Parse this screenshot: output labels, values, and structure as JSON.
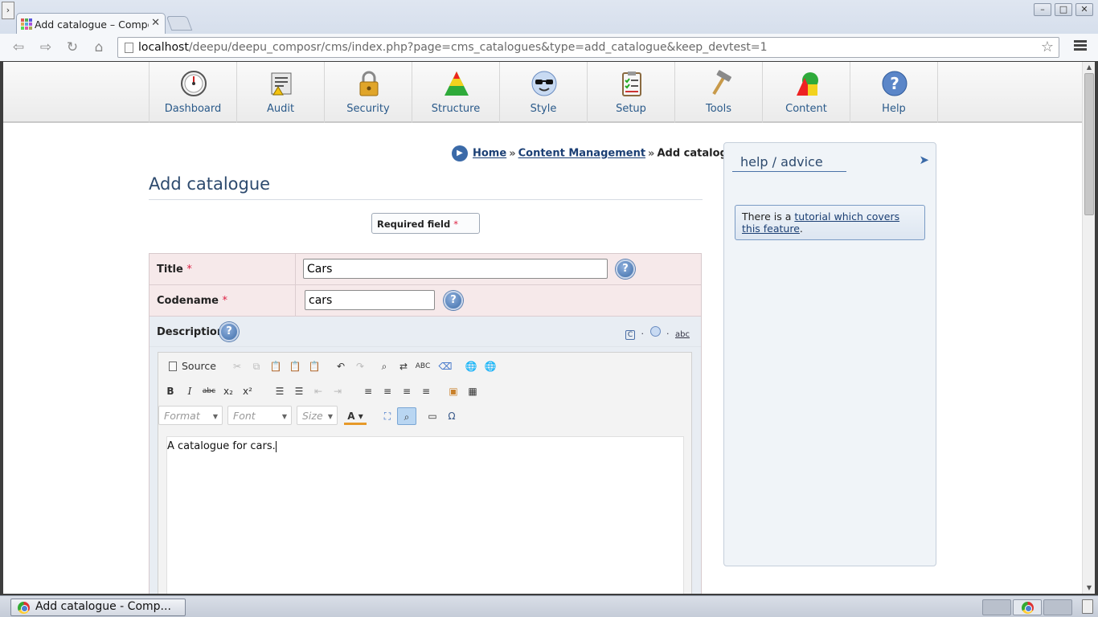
{
  "browser": {
    "tab_title": "Add catalogue – Compo",
    "url_host": "localhost",
    "url_path": "/deepu/deepu_composr/cms/index.php?page=cms_catalogues&type=add_catalogue&keep_devtest=1",
    "side_toggle": "›"
  },
  "admin_menu": {
    "items": [
      {
        "label": "Dashboard",
        "icon": "dashboard-gauge-icon"
      },
      {
        "label": "Audit",
        "icon": "audit-log-icon"
      },
      {
        "label": "Security",
        "icon": "padlock-icon"
      },
      {
        "label": "Structure",
        "icon": "pyramid-icon"
      },
      {
        "label": "Style",
        "icon": "sunglasses-face-icon"
      },
      {
        "label": "Setup",
        "icon": "clipboard-checklist-icon"
      },
      {
        "label": "Tools",
        "icon": "hammer-icon"
      },
      {
        "label": "Content",
        "icon": "shapes-icon"
      },
      {
        "label": "Help",
        "icon": "question-mark-icon"
      }
    ]
  },
  "breadcrumb": {
    "home": "Home",
    "sep": "»",
    "content_management": "Content Management",
    "current": "Add catalogue"
  },
  "page": {
    "title": "Add catalogue",
    "required_label": "Required field",
    "required_mark": "*"
  },
  "form": {
    "title_label": "Title",
    "title_value": "Cars",
    "codename_label": "Codename",
    "codename_value": "cars",
    "description_label": "Description",
    "help_glyph": "?",
    "desc_tools": [
      "Comcode",
      "·",
      "WYSIWYG",
      "·",
      "spellcheck"
    ]
  },
  "editor": {
    "source_label": "Source",
    "format_placeholder": "Format",
    "font_placeholder": "Font",
    "size_placeholder": "Size",
    "content": "A catalogue for cars."
  },
  "help_panel": {
    "title": "help / advice",
    "note_prefix": "There is a ",
    "note_link": "tutorial which covers this feature",
    "note_suffix": "."
  },
  "taskbar": {
    "window_label": "Add catalogue - Comp..."
  },
  "colors": {
    "link": "#1b3f74",
    "required_row": "#f6e9ea",
    "menu_label": "#2a5a8a"
  }
}
